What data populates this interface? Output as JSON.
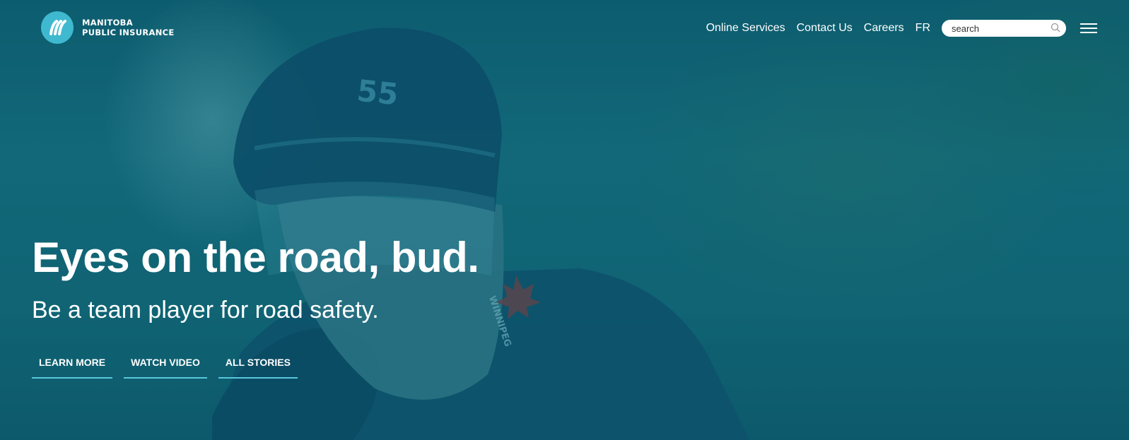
{
  "brand": {
    "line1": "MANITOBA",
    "line2": "PUBLIC INSURANCE",
    "accent": "#3fb9cf"
  },
  "nav": {
    "items": [
      "Online Services",
      "Contact Us",
      "Careers",
      "FR"
    ],
    "search_placeholder": "search",
    "search_icon": "search-icon",
    "menu_icon": "hamburger-menu-icon"
  },
  "hero": {
    "headline": "Eyes on the road, bud.",
    "subheadline": "Be a team player for road safety.",
    "buttons": [
      "LEARN MORE",
      "WATCH VIDEO",
      "ALL STORIES"
    ],
    "helmet_number": "55",
    "jersey_text": "WINNIPEG",
    "underline_color": "#59c7dc"
  }
}
